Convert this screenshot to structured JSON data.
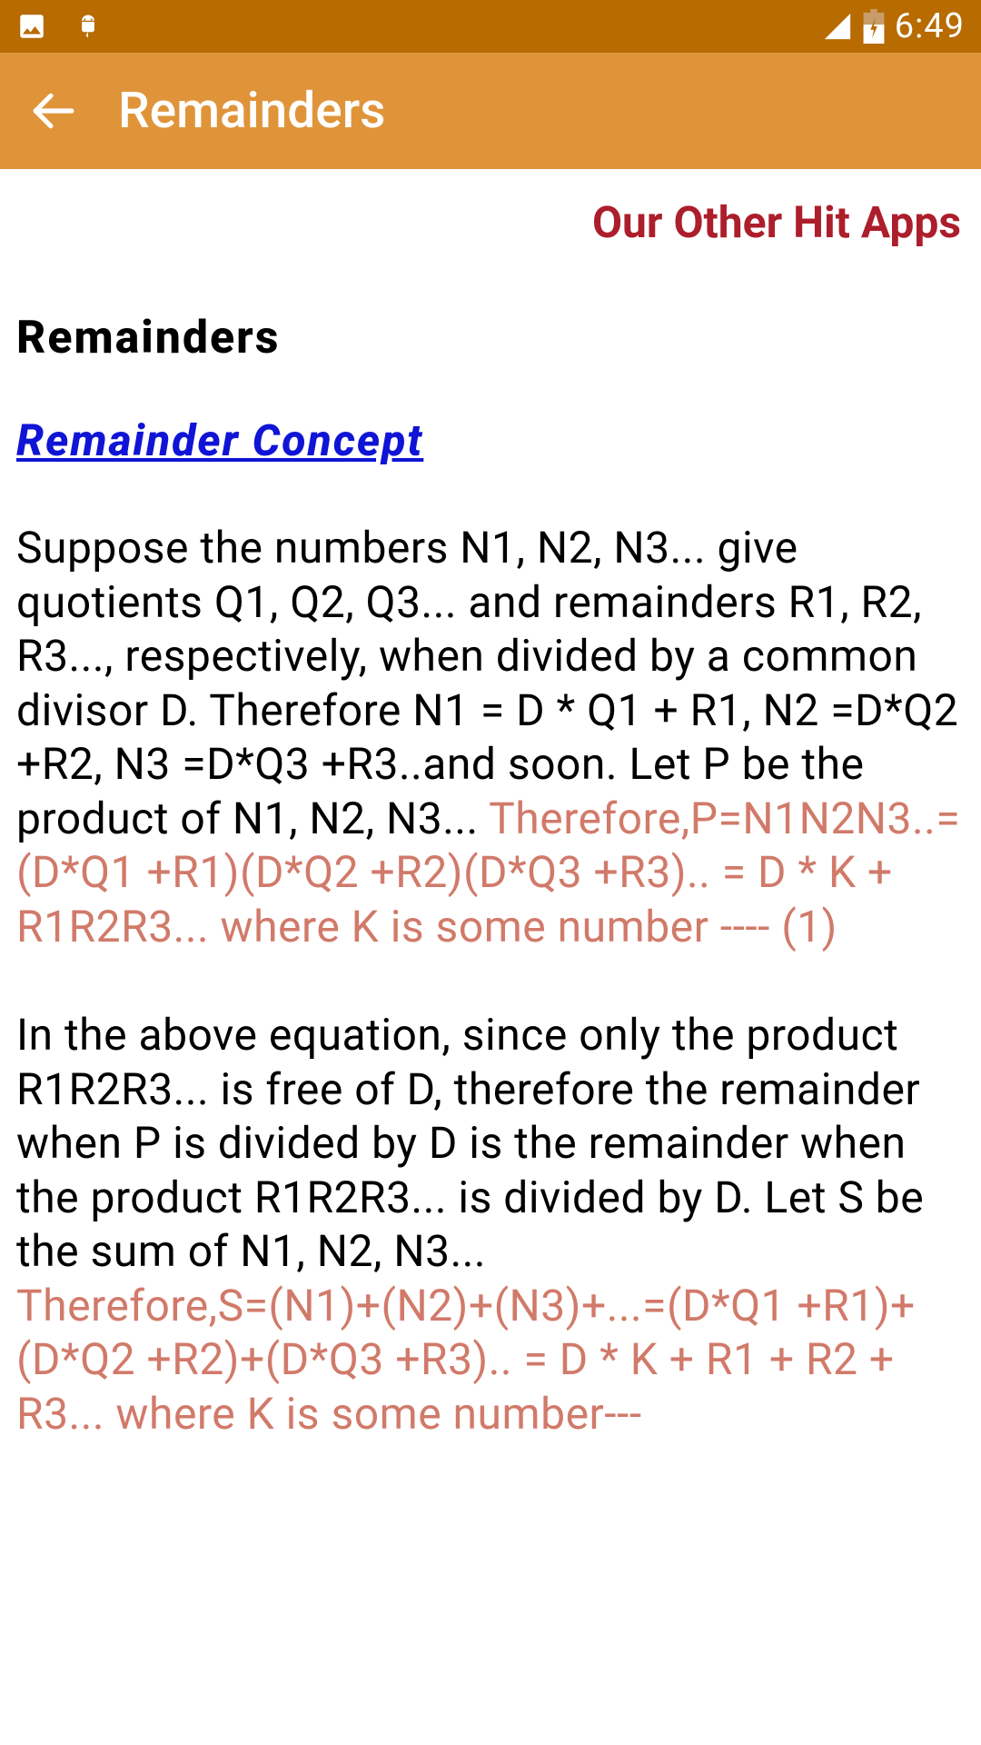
{
  "status": {
    "time": "6:49"
  },
  "appbar": {
    "title": "Remainders"
  },
  "hit_apps": "Our Other Hit Apps",
  "heading": "Remainders",
  "concept_link": "Remainder Concept",
  "p1_black": "Suppose the numbers N1, N2, N3... give quotients Q1, Q2, Q3... and remainders R1, R2, R3..., respectively, when divided by a common divisor D. Therefore N1 = D * Q1 + R1, N2 =D*Q2 +R2, N3 =D*Q3 +R3..and soon. Let P be the product of N1, N2, N3... ",
  "p1_red": "Therefore,P=N1N2N3..=(D*Q1 +R1)(D*Q2 +R2)(D*Q3 +R3).. = D * K + R1R2R3... where K is some number ---- (1)",
  "p2_black": "In the above equation, since only the product R1R2R3... is free of D, therefore the remainder when P is divided by D is the remainder when the product R1R2R3... is divided by D. Let S be the sum of N1, N2, N3...",
  "p2_red": "Therefore,S=(N1)+(N2)+(N3)+...=(D*Q1 +R1)+(D*Q2 +R2)+(D*Q3 +R3).. = D * K + R1 + R2 + R3... where K is some number---"
}
